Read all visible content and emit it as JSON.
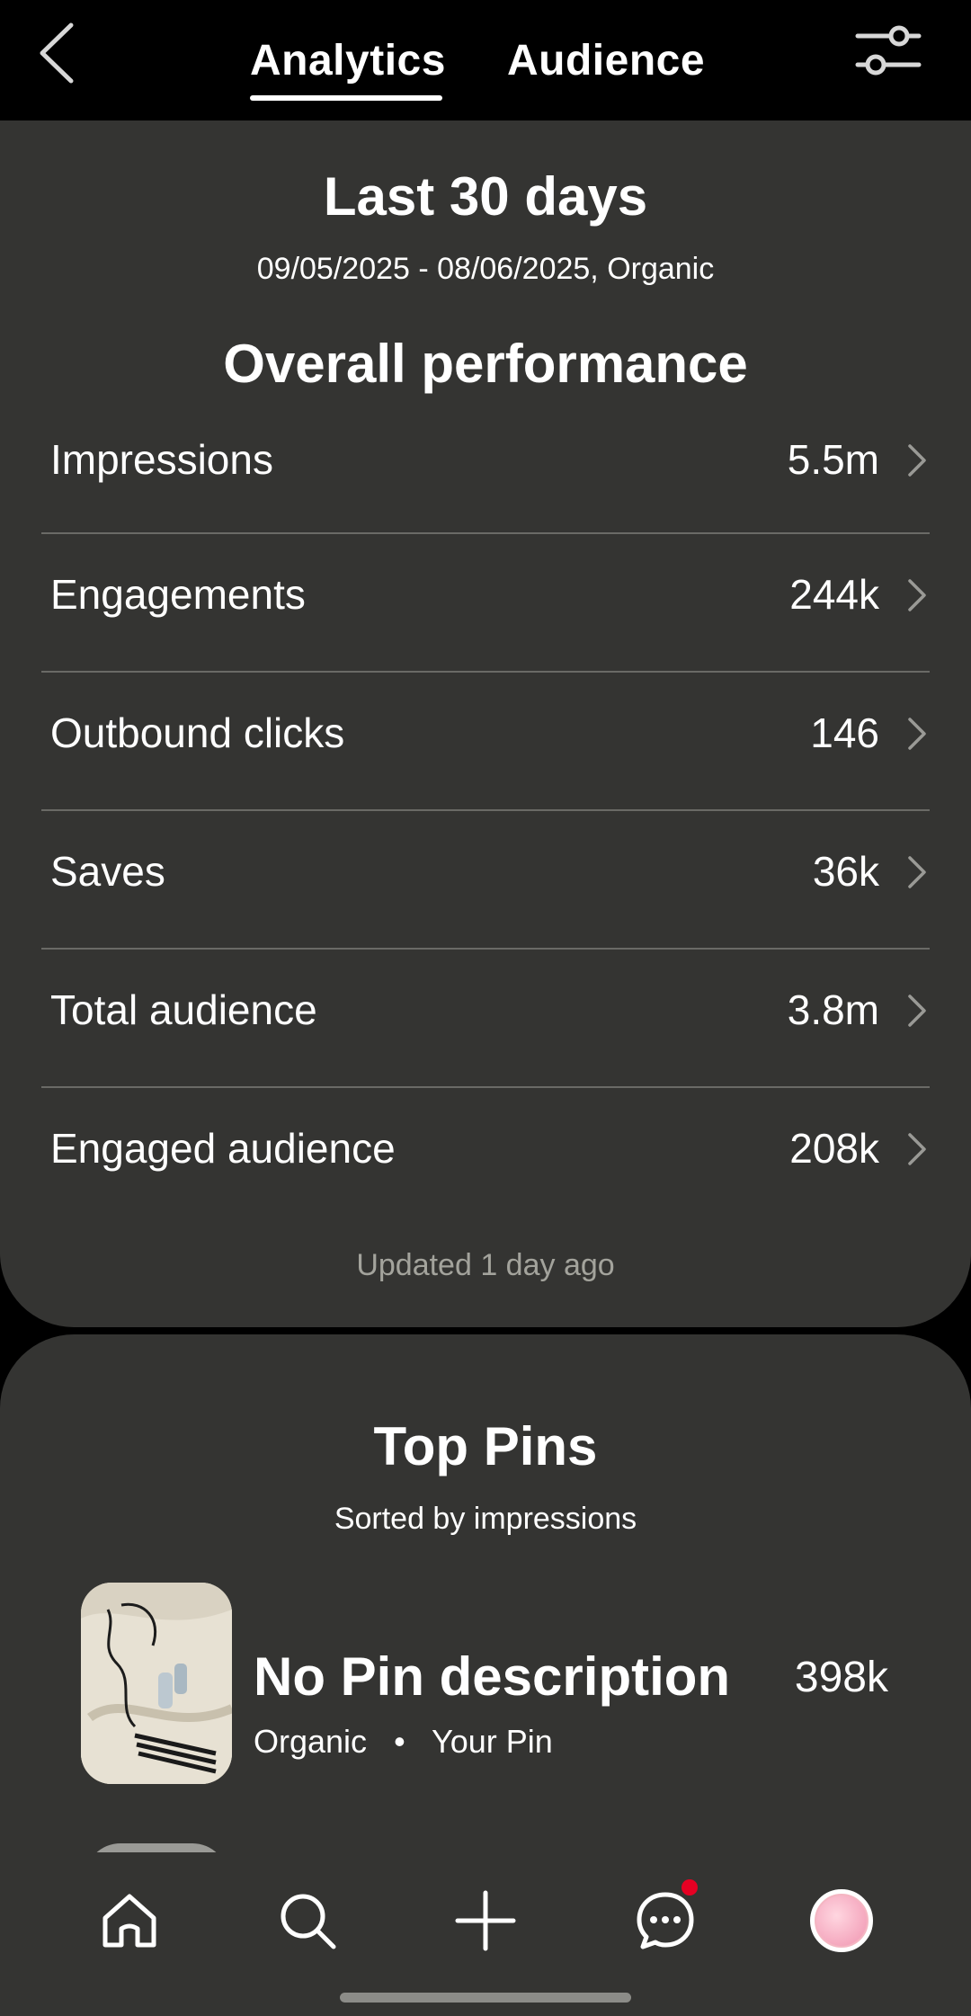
{
  "header": {
    "tabs": [
      {
        "label": "Analytics",
        "active": true
      },
      {
        "label": "Audience",
        "active": false
      }
    ]
  },
  "performance": {
    "period_title": "Last 30 days",
    "period_range": "09/05/2025 - 08/06/2025, Organic",
    "section_title": "Overall performance",
    "metrics": [
      {
        "label": "Impressions",
        "value": "5.5m"
      },
      {
        "label": "Engagements",
        "value": "244k"
      },
      {
        "label": "Outbound clicks",
        "value": "146"
      },
      {
        "label": "Saves",
        "value": "36k"
      },
      {
        "label": "Total audience",
        "value": "3.8m"
      },
      {
        "label": "Engaged audience",
        "value": "208k"
      }
    ],
    "updated": "Updated 1 day ago"
  },
  "top_pins": {
    "title": "Top Pins",
    "subtitle": "Sorted by impressions",
    "pins": [
      {
        "title": "No Pin description",
        "source": "Organic",
        "separator": "•",
        "owner": "Your Pin",
        "value": "398k"
      }
    ]
  },
  "nav": {
    "items": [
      "home-icon",
      "search-icon",
      "plus-icon",
      "messages-icon",
      "profile-avatar"
    ],
    "has_notification": true,
    "notification_color": "#e60023"
  },
  "colors": {
    "background": "#000000",
    "card": "#343432",
    "divider": "#6a6a66",
    "muted_text": "#a3a39c"
  }
}
